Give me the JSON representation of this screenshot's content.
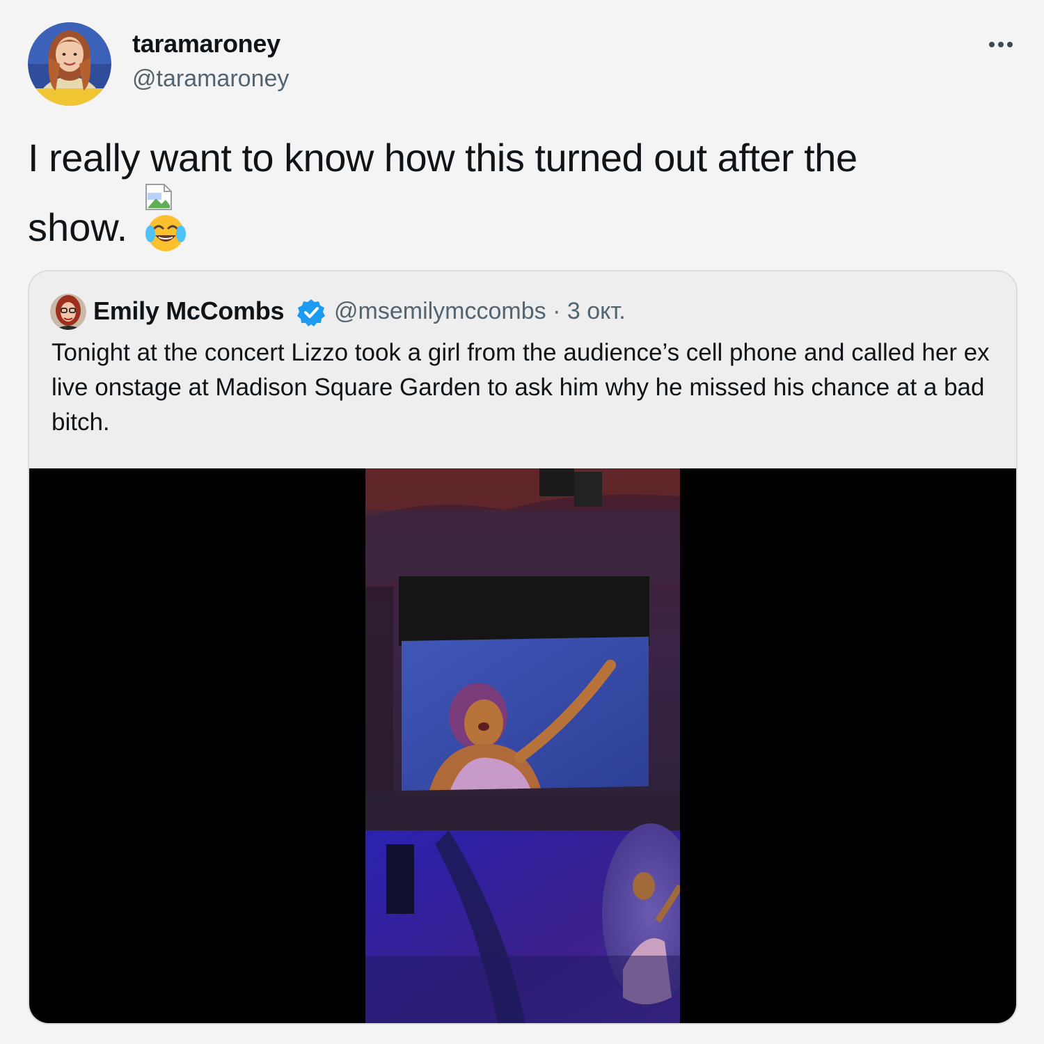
{
  "tweet": {
    "display_name": "taramaroney",
    "handle": "@taramaroney",
    "text_line1": "I really want to know how this turned out after the",
    "text_line2": "show.",
    "more_icon": "more-horizontal-icon",
    "emoji_icon": "face-with-tears-of-joy-icon",
    "broken_image_icon": "broken-image-icon"
  },
  "quote": {
    "display_name": "Emily McCombs",
    "verified_icon": "verified-badge-icon",
    "handle": "@msemilymccombs",
    "separator": "·",
    "date": "3 окт.",
    "text": "Tonight at the concert Lizzo took a girl from the audience’s cell phone and called her ex live onstage at Madison Square Garden to ask him why he missed his chance at a bad bitch.",
    "media_type": "video"
  },
  "colors": {
    "background": "#f4f4f4",
    "secondary_text": "#536471",
    "verified_blue": "#1d9bf0",
    "card_border": "#dcdcdc"
  }
}
